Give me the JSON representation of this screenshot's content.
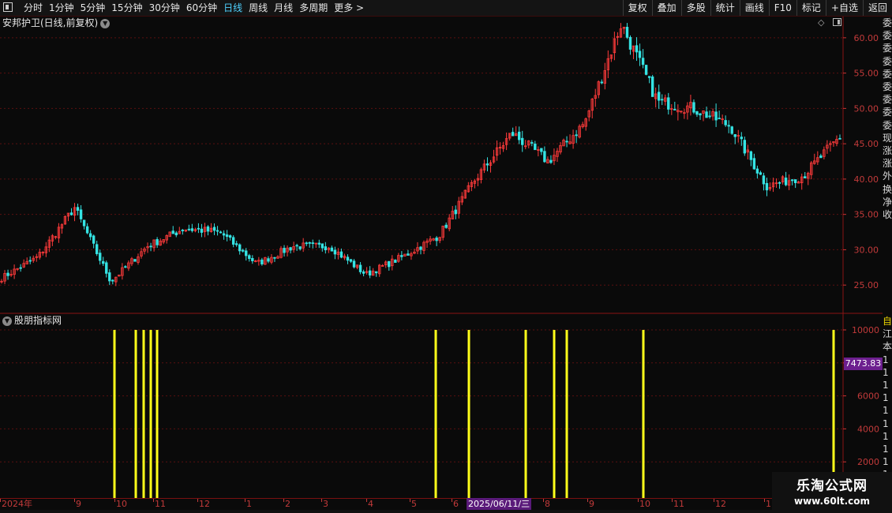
{
  "toolbar": {
    "period_tabs": [
      "分时",
      "1分钟",
      "5分钟",
      "15分钟",
      "30分钟",
      "60分钟",
      "日线",
      "周线",
      "月线",
      "多周期",
      "更多 >"
    ],
    "active_tab": "日线",
    "right_tools": [
      "复权",
      "叠加",
      "多股",
      "统计",
      "画线",
      "F10",
      "标记",
      "+自选",
      "返回"
    ]
  },
  "main_chart": {
    "title": "安邦护卫(日线,前复权)",
    "up_color": "#ff3b3b",
    "down_color": "#35e3e3"
  },
  "sub_chart": {
    "title": "股朋指标网",
    "bar_color": "#ffff1a",
    "current_value": "7473.83"
  },
  "right_strip": {
    "top_chars": [
      "委",
      "委",
      "委",
      "委",
      "委",
      "委",
      "委",
      "委",
      "委",
      "现",
      "涨",
      "涨",
      "外",
      "换",
      "净",
      "收"
    ],
    "bottom_chars": [
      "自",
      "江",
      "本",
      "1",
      "1",
      "1",
      "1",
      "1",
      "1",
      "1",
      "1",
      "1",
      "1"
    ]
  },
  "time_axis": {
    "labels": [
      "2024年",
      "9",
      "10",
      "11",
      "12",
      "1",
      "2",
      "3",
      "4",
      "5",
      "6",
      "2025/06/11/三",
      "7",
      "8",
      "9",
      "10",
      "11",
      "12",
      "1"
    ]
  },
  "watermark": {
    "title": "乐淘公式网",
    "url": "www.60lt.com"
  },
  "chart_data": [
    {
      "type": "candlestick",
      "title": "安邦护卫(日线,前复权)",
      "y_axis_ticks": [
        25,
        30,
        35,
        40,
        45,
        50,
        55,
        60
      ],
      "ylim": [
        21,
        63
      ],
      "x_axis_labels": [
        "2024年",
        "9",
        "10",
        "11",
        "12",
        "1",
        "2",
        "3",
        "4",
        "5",
        "6",
        "7",
        "8",
        "9",
        "10",
        "11",
        "12",
        "1"
      ],
      "approx_close_path": [
        {
          "date": "2024-08",
          "close": 26.0
        },
        {
          "date": "2024-08-mid",
          "close": 29.0
        },
        {
          "date": "2024-08-spike",
          "close": 36.0
        },
        {
          "date": "2024-09",
          "close": 25.5
        },
        {
          "date": "2024-10",
          "close": 30.5
        },
        {
          "date": "2024-11",
          "close": 33.0
        },
        {
          "date": "2024-12",
          "close": 32.5
        },
        {
          "date": "2025-01",
          "close": 28.0
        },
        {
          "date": "2025-02",
          "close": 30.5
        },
        {
          "date": "2025-03",
          "close": 30.5
        },
        {
          "date": "2025-04",
          "close": 26.5
        },
        {
          "date": "2025-05",
          "close": 29.0
        },
        {
          "date": "2025-06",
          "close": 32.0
        },
        {
          "date": "2025-06-mid",
          "close": 40.0
        },
        {
          "date": "2025-07",
          "close": 46.5
        },
        {
          "date": "2025-07-mid",
          "close": 42.5
        },
        {
          "date": "2025-08",
          "close": 48.0
        },
        {
          "date": "2025-08-mid",
          "close": 62.0
        },
        {
          "date": "2025-09",
          "close": 51.0
        },
        {
          "date": "2025-10",
          "close": 50.0
        },
        {
          "date": "2025-11",
          "close": 47.5
        },
        {
          "date": "2025-12",
          "close": 39.0
        },
        {
          "date": "2026-01",
          "close": 40.5
        },
        {
          "date": "2026-01-end",
          "close": 46.0
        }
      ]
    },
    {
      "type": "bar",
      "title": "股朋指标网",
      "y_axis_ticks": [
        2000,
        4000,
        6000,
        8000,
        10000
      ],
      "ylim": [
        0,
        10000
      ],
      "current_value": 7473.83,
      "signal_bars": [
        {
          "date": "2024-10-a",
          "value": 10000
        },
        {
          "date": "2024-10-b",
          "value": 10000
        },
        {
          "date": "2024-10-c",
          "value": 10000
        },
        {
          "date": "2024-11-a",
          "value": 10000
        },
        {
          "date": "2024-11-b",
          "value": 10000
        },
        {
          "date": "2025-05",
          "value": 10000
        },
        {
          "date": "2025-06",
          "value": 10000
        },
        {
          "date": "2025-07",
          "value": 10000
        },
        {
          "date": "2025-08-a",
          "value": 10000
        },
        {
          "date": "2025-08-b",
          "value": 10000
        },
        {
          "date": "2025-10",
          "value": 10000
        },
        {
          "date": "2026-01",
          "value": 10000
        }
      ]
    }
  ]
}
